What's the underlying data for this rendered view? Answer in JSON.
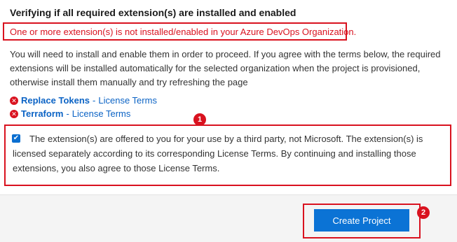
{
  "title": "Verifying if all required extension(s) are installed and enabled",
  "warning": "One or more extension(s) is not installed/enabled in your Azure DevOps Organization.",
  "description": "You will need to install and enable them in order to proceed. If you agree with the terms below, the required extensions will be installed automatically for the selected organization when the project is provisioned, otherwise install them manually and try refreshing the page",
  "extensions": [
    {
      "name": "Replace Tokens",
      "separator": "-",
      "license": "License Terms",
      "status_icon": "error-x-icon"
    },
    {
      "name": "Terraform",
      "separator": "-",
      "license": "License Terms",
      "status_icon": "error-x-icon"
    }
  ],
  "agreement": {
    "checked": true,
    "text": "The extension(s) are offered to you for your use by a third party, not Microsoft. The extension(s) is licensed separately according to its corresponding License Terms. By continuing and installing those extensions, you also agree to those License Terms."
  },
  "badges": [
    "1",
    "2"
  ],
  "create_button": "Create Project",
  "colors": {
    "accent": "#0b73d5",
    "error": "#d9121f"
  }
}
